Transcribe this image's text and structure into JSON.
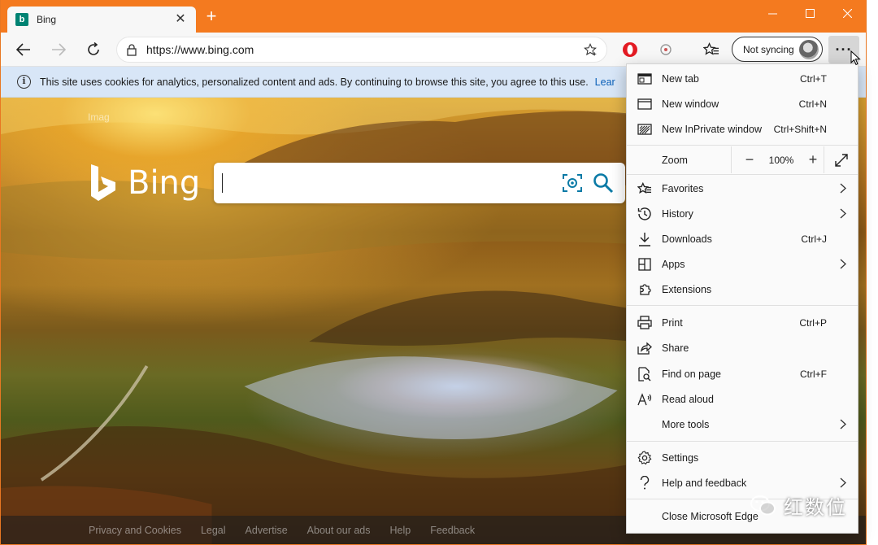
{
  "tab": {
    "title": "Bing",
    "favicon": "b"
  },
  "address": {
    "url": "https://www.bing.com"
  },
  "sync": {
    "label": "Not syncing"
  },
  "more_button": {
    "label": "···"
  },
  "infobar": {
    "text": "This site uses cookies for analytics, personalized content and ads. By continuing to browse this site, you agree to this use.",
    "link": "Lear"
  },
  "page": {
    "image_label": "Imag",
    "logo_text": "Bing",
    "search_value": ""
  },
  "footer": {
    "links": [
      "Privacy and Cookies",
      "Legal",
      "Advertise",
      "About our ads",
      "Help",
      "Feedback"
    ]
  },
  "menu": {
    "new_tab": {
      "label": "New tab",
      "shortcut": "Ctrl+T"
    },
    "new_window": {
      "label": "New window",
      "shortcut": "Ctrl+N"
    },
    "new_inprivate": {
      "label": "New InPrivate window",
      "shortcut": "Ctrl+Shift+N"
    },
    "zoom": {
      "label": "Zoom",
      "minus": "−",
      "value": "100%",
      "plus": "+"
    },
    "favorites": {
      "label": "Favorites"
    },
    "history": {
      "label": "History"
    },
    "downloads": {
      "label": "Downloads",
      "shortcut": "Ctrl+J"
    },
    "apps": {
      "label": "Apps"
    },
    "extensions": {
      "label": "Extensions"
    },
    "print": {
      "label": "Print",
      "shortcut": "Ctrl+P"
    },
    "share": {
      "label": "Share"
    },
    "find": {
      "label": "Find on page",
      "shortcut": "Ctrl+F"
    },
    "read_aloud": {
      "label": "Read aloud"
    },
    "more_tools": {
      "label": "More tools"
    },
    "settings": {
      "label": "Settings"
    },
    "help": {
      "label": "Help and feedback"
    },
    "close": {
      "label": "Close Microsoft Edge"
    }
  },
  "watermark": {
    "text": "红数位"
  },
  "colors": {
    "titlebar": "#f47a1f",
    "menu_bg": "#fafafa",
    "infobar": "#d8e6f7",
    "bing_teal": "#008373"
  }
}
